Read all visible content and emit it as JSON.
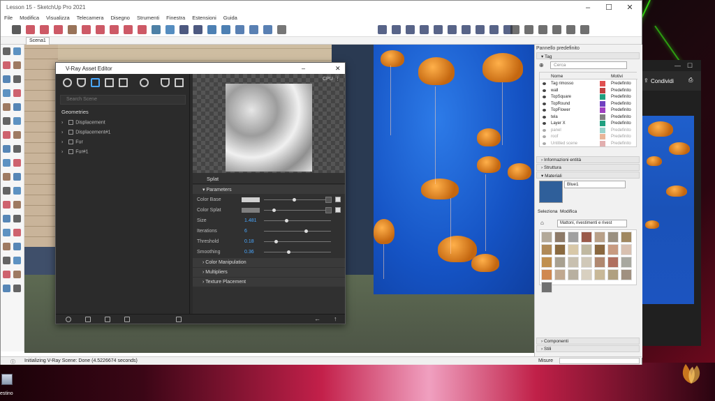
{
  "desktop": {
    "icon_label": "estino",
    "brand_colors": {
      "accent_green": "#39ff14",
      "accent_pink": "#e0306a"
    }
  },
  "photos_window": {
    "share_label": "Condividi"
  },
  "sketchup": {
    "title": "Lesson 15 - SketchUp Pro 2021",
    "menu": [
      "File",
      "Modifica",
      "Visualizza",
      "Telecamera",
      "Disegno",
      "Strumenti",
      "Finestra",
      "Estensioni",
      "Guida"
    ],
    "scene_tab": "Scena1",
    "status_text": "Initializing V-Ray Scene: Done (4.5226674 seconds)",
    "measure_label": "Misure"
  },
  "vray": {
    "title": "V-Ray Asset Editor",
    "search_placeholder": "Search Scene",
    "section": "Geometries",
    "tree": [
      "Displacement",
      "Displacement#1",
      "Fur",
      "Fur#1"
    ],
    "render_mode": "CPU",
    "plugin_title": "Splat",
    "groups": {
      "parameters": "Parameters",
      "color_manipulation": "Color Manipulation",
      "multipliers": "Multipliers",
      "texture_placement": "Texture Placement"
    },
    "params": [
      {
        "label": "Color Base",
        "value": "",
        "swatch": "#d0d0d0",
        "slider": 0.45
      },
      {
        "label": "Color Splat",
        "value": "",
        "swatch": "#808080",
        "slider": 0.15
      },
      {
        "label": "Size",
        "value": "1.481",
        "slider": 0.33
      },
      {
        "label": "Iterations",
        "value": "6",
        "slider": 0.62
      },
      {
        "label": "Threshold",
        "value": "0.18",
        "slider": 0.18
      },
      {
        "label": "Smoothing",
        "value": "0.36",
        "slider": 0.36
      }
    ]
  },
  "tray": {
    "title": "Pannello predefinito",
    "tag_section": "Tag",
    "search_placeholder": "Cerca",
    "columns": {
      "name": "Nome",
      "pattern": "Motivi"
    },
    "tags": [
      {
        "name": "Tag rimosso",
        "color": "#e05050",
        "mode": "Predefinito"
      },
      {
        "name": "wall",
        "color": "#c04040",
        "mode": "Predefinito"
      },
      {
        "name": "TopSquare",
        "color": "#20a080",
        "mode": "Predefinito"
      },
      {
        "name": "TopRound",
        "color": "#7040c0",
        "mode": "Predefinito"
      },
      {
        "name": "TopFlower",
        "color": "#a040c0",
        "mode": "Predefinito"
      },
      {
        "name": "tela",
        "color": "#808080",
        "mode": "Predefinito"
      },
      {
        "name": "Layer X",
        "color": "#20a080",
        "mode": "Predefinito"
      },
      {
        "name": "panel",
        "color": "#20a090",
        "mode": "Predefinito"
      },
      {
        "name": "roof",
        "color": "#d06020",
        "mode": "Predefinito"
      },
      {
        "name": "Untitled scene",
        "color": "#c05050",
        "mode": "Predefinito"
      }
    ],
    "sections": {
      "entity_info": "Informazioni entità",
      "structure": "Struttura",
      "materials": "Materiali",
      "components": "Componenti",
      "styles": "Stili",
      "shadows": "Ombreggiatura"
    },
    "material_name": "Blue1",
    "material_color": "#2f5f9a",
    "mat_tabs": {
      "select": "Seleziona",
      "edit": "Modifica"
    },
    "mat_library": "Mattoni, rivestimenti e rivest",
    "material_swatches": [
      "#b3a999",
      "#8d7a68",
      "#a0a0a0",
      "#9a5a4a",
      "#b8a088",
      "#9a9080",
      "#a08860",
      "#b08a58",
      "#8a6a40",
      "#d8c8a8",
      "#c0b8a0",
      "#8a6840",
      "#c89a80",
      "#d8c0b0",
      "#c09050",
      "#a8a090",
      "#c8c0b0",
      "#d0c8b8",
      "#b08870",
      "#b07060",
      "#a8a8a0",
      "#d08850",
      "#c0a890",
      "#b8b0a0",
      "#d8d0c0",
      "#c8b898",
      "#b0a080",
      "#a09080",
      "#707070"
    ]
  }
}
